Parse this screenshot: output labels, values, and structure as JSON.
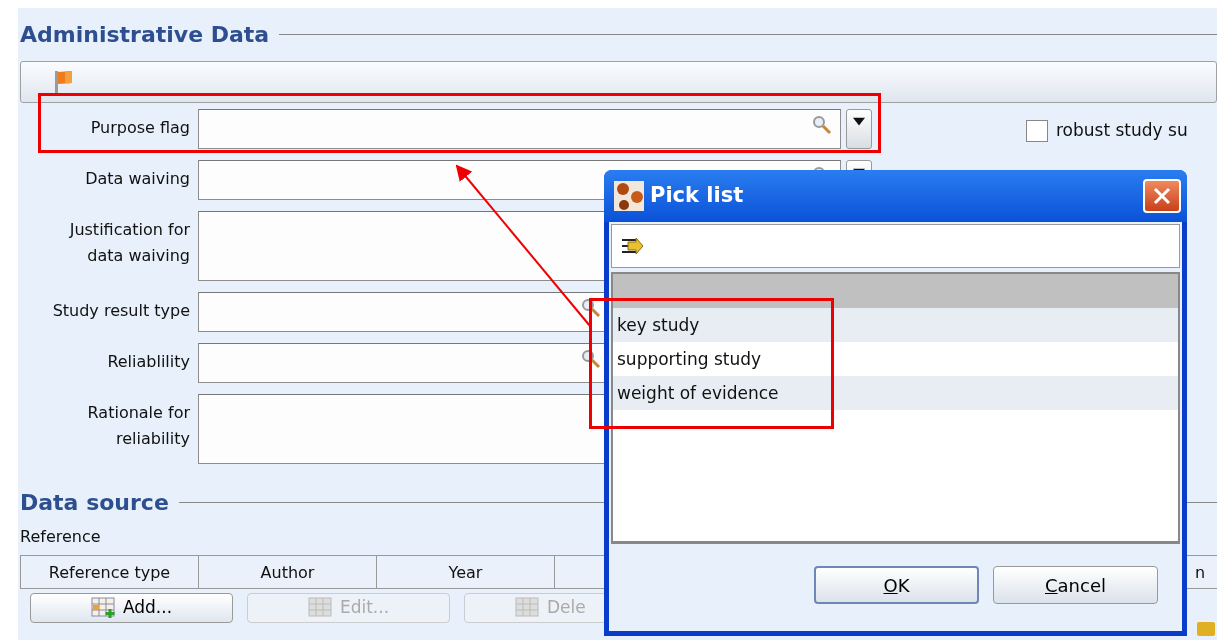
{
  "section_title": "Administrative Data",
  "fields": [
    {
      "label": "Purpose flag",
      "kind": "picklist",
      "dropdown": true,
      "checkbox": {
        "label": "robust study su",
        "checked": false
      }
    },
    {
      "label": "Data waiving",
      "kind": "picklist",
      "dropdown": true
    },
    {
      "label": "Justification for data waiving",
      "kind": "textarea"
    },
    {
      "label": "Study result type",
      "kind": "picklist"
    },
    {
      "label": "Reliablility",
      "kind": "picklist"
    },
    {
      "label": "Rationale for reliability",
      "kind": "textarea"
    }
  ],
  "data_source": {
    "title": "Data source",
    "reference_label": "Reference",
    "columns": [
      "Reference type",
      "Author",
      "Year",
      "n"
    ],
    "buttons": [
      {
        "label": "Add...",
        "disabled": false
      },
      {
        "label": "Edit...",
        "disabled": true
      },
      {
        "label": "Dele",
        "disabled": true
      }
    ]
  },
  "dialog": {
    "title": "Pick list",
    "items": [
      {
        "label": "key study"
      },
      {
        "label": "supporting study"
      },
      {
        "label": "weight of evidence"
      }
    ],
    "buttons": [
      {
        "label": "OK",
        "default": true
      },
      {
        "label": "Cancel",
        "default": false
      }
    ]
  }
}
